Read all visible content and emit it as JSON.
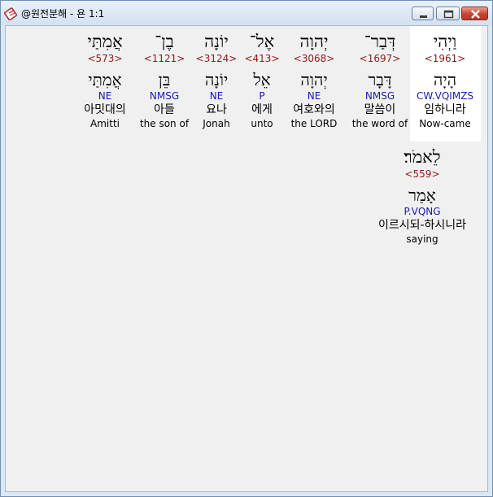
{
  "window": {
    "title": "@원전분해 - 욘 1:1",
    "icon": "bible-app-icon"
  },
  "titlebar_buttons": {
    "minimize": "minimize-icon",
    "maximize": "maximize-icon",
    "close": "close-icon"
  },
  "words": [
    {
      "hebrew": "וַיְהִי",
      "strongs": "<1961>",
      "lemma": "הָיָה",
      "morph": "CW.VQIMZS",
      "korean": "임하니라",
      "english": "Now-came",
      "selected": true
    },
    {
      "hebrew": "דְּבַר־",
      "strongs": "<1697>",
      "lemma": "דָּבָר",
      "morph": "NMSG",
      "korean": "말씀이",
      "english": "the word of",
      "selected": false
    },
    {
      "hebrew": "יְהוָה",
      "strongs": "<3068>",
      "lemma": "יְהוָה",
      "morph": "NE",
      "korean": "여호와의",
      "english": "the LORD",
      "selected": false
    },
    {
      "hebrew": "אֶל־",
      "strongs": "<413>",
      "lemma": "אֵל",
      "morph": "P",
      "korean": "에게",
      "english": "unto",
      "selected": false
    },
    {
      "hebrew": "יוֹנָה",
      "strongs": "<3124>",
      "lemma": "יוֹנָה",
      "morph": "NE",
      "korean": "요나",
      "english": "Jonah",
      "selected": false
    },
    {
      "hebrew": "בֶן־",
      "strongs": "<1121>",
      "lemma": "בֵּן",
      "morph": "NMSG",
      "korean": "아들",
      "english": "the son of",
      "selected": false
    },
    {
      "hebrew": "אֲמִתַּי",
      "strongs": "<573>",
      "lemma": "אֲמִתַּי",
      "morph": "NE",
      "korean": "아밋대의",
      "english": "Amitti",
      "selected": false
    },
    {
      "hebrew": "לֵאמֹר׃",
      "strongs": "<559>",
      "lemma": "אָמַר",
      "morph": "P.VQNG",
      "korean": "이르시되-하시니라",
      "english": "saying",
      "selected": false
    }
  ],
  "colors": {
    "strongs": "#8b1a1a",
    "morph": "#1a1ab0",
    "background": "#f0f0f0",
    "selected_background": "#ffffff"
  }
}
